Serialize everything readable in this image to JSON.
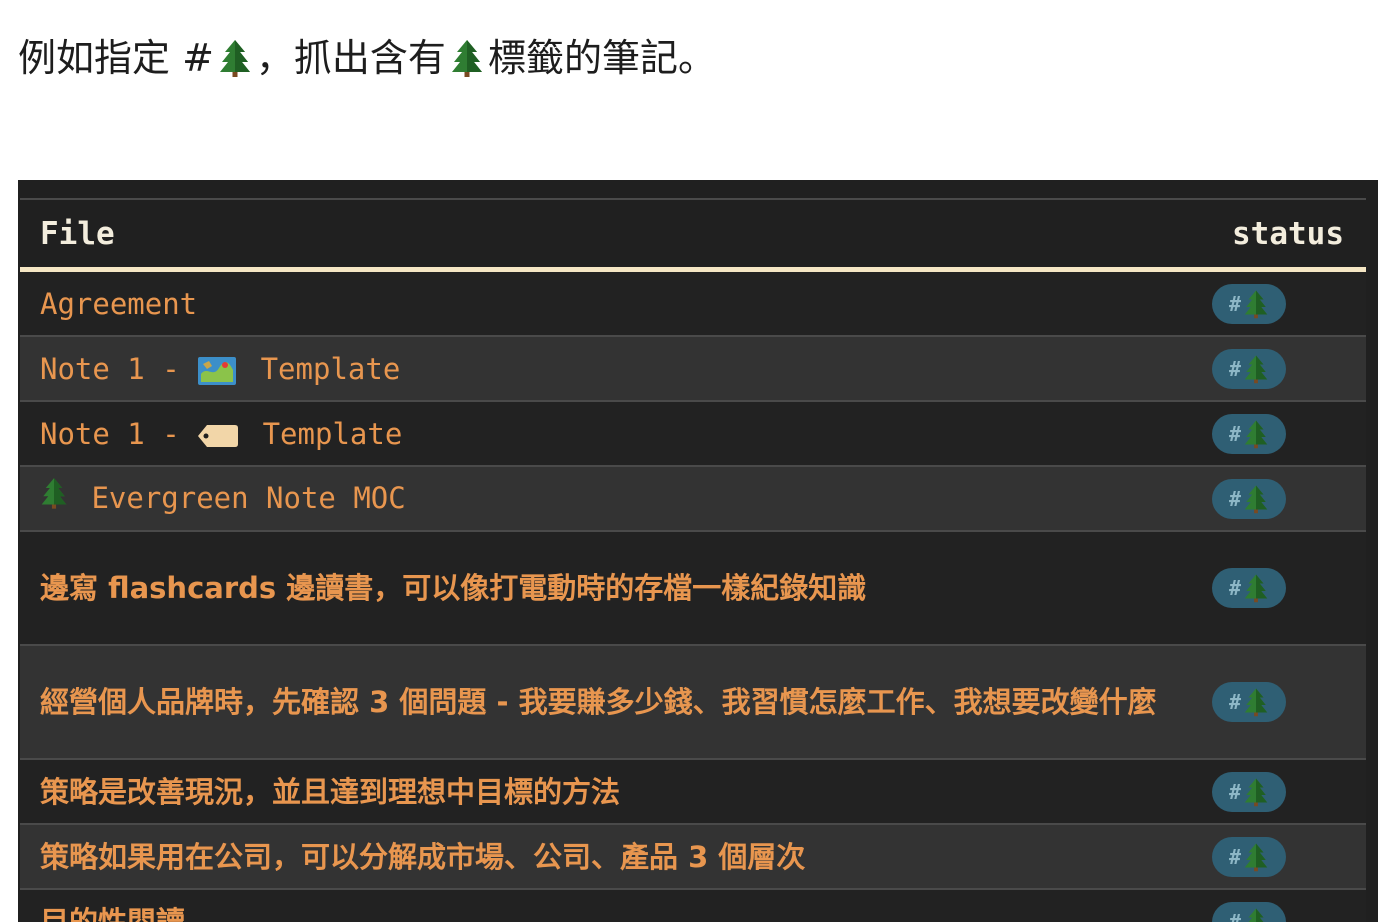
{
  "caption": {
    "part1": "例如指定 #",
    "part2": "，抓出含有 ",
    "part3": " 標籤的筆記。",
    "icon": "evergreen-tree-icon"
  },
  "table": {
    "headers": {
      "file": "File",
      "status": "status"
    },
    "tag": {
      "hash": "#",
      "icon": "evergreen-tree-icon"
    },
    "rows": [
      {
        "prefix": "",
        "prefix_icon": "",
        "text": "Agreement",
        "font": "mono"
      },
      {
        "prefix": "Note 1 - ",
        "prefix_icon": "map-icon",
        "text": " Template",
        "font": "mono"
      },
      {
        "prefix": "Note 1 - ",
        "prefix_icon": "label-tag-icon",
        "text": " Template",
        "font": "mono"
      },
      {
        "prefix": "",
        "prefix_icon": "evergreen-tree-icon",
        "text": " Evergreen Note MOC",
        "font": "mono"
      },
      {
        "prefix": "",
        "prefix_icon": "",
        "text": "邊寫 flashcards 邊讀書，可以像打電動時的存檔一樣紀錄知識",
        "font": "cjk"
      },
      {
        "prefix": "",
        "prefix_icon": "",
        "text": "經營個人品牌時，先確認 3 個問題 - 我要賺多少錢、我習慣怎麼工作、我想要改變什麼",
        "font": "cjk"
      },
      {
        "prefix": "",
        "prefix_icon": "",
        "text": "策略是改善現況，並且達到理想中目標的方法",
        "font": "cjk"
      },
      {
        "prefix": "",
        "prefix_icon": "",
        "text": "策略如果用在公司，可以分解成市場、公司、產品 3 個層次",
        "font": "cjk"
      },
      {
        "prefix": "",
        "prefix_icon": "",
        "text": "目的性閱讀",
        "font": "cjk"
      }
    ]
  },
  "colors": {
    "panel_bg": "#202020",
    "row_alt_bg": "#333333",
    "link": "#e8964f",
    "header_text": "#f3eddd",
    "header_rule": "#f5e6c4",
    "tag_bg": "#2f5f74"
  }
}
